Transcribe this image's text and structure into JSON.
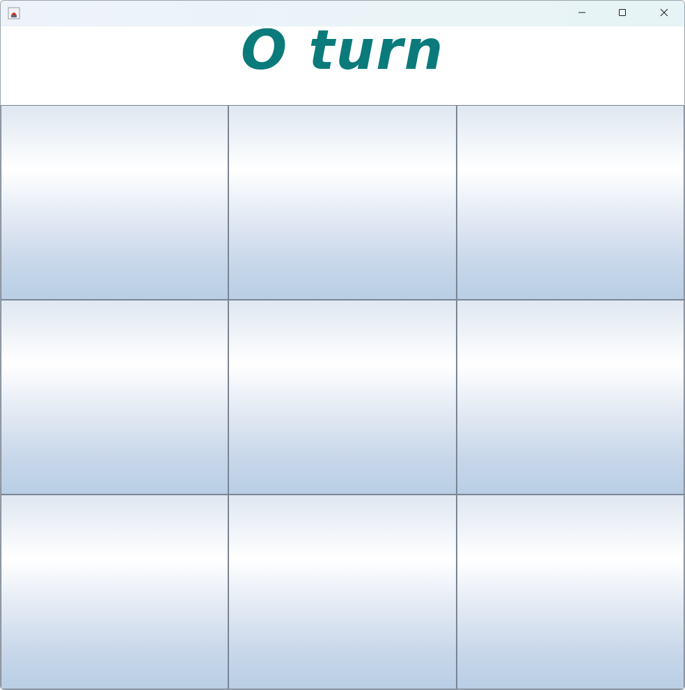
{
  "window": {
    "icons": {
      "app": "java-cup-icon",
      "minimize": "minimize-icon",
      "maximize": "maximize-icon",
      "close": "close-icon"
    }
  },
  "header": {
    "turn_text": "O turn",
    "turn_color": "#0b7a7a"
  },
  "board": {
    "cells": [
      {
        "value": ""
      },
      {
        "value": ""
      },
      {
        "value": ""
      },
      {
        "value": ""
      },
      {
        "value": ""
      },
      {
        "value": ""
      },
      {
        "value": ""
      },
      {
        "value": ""
      },
      {
        "value": ""
      }
    ]
  }
}
